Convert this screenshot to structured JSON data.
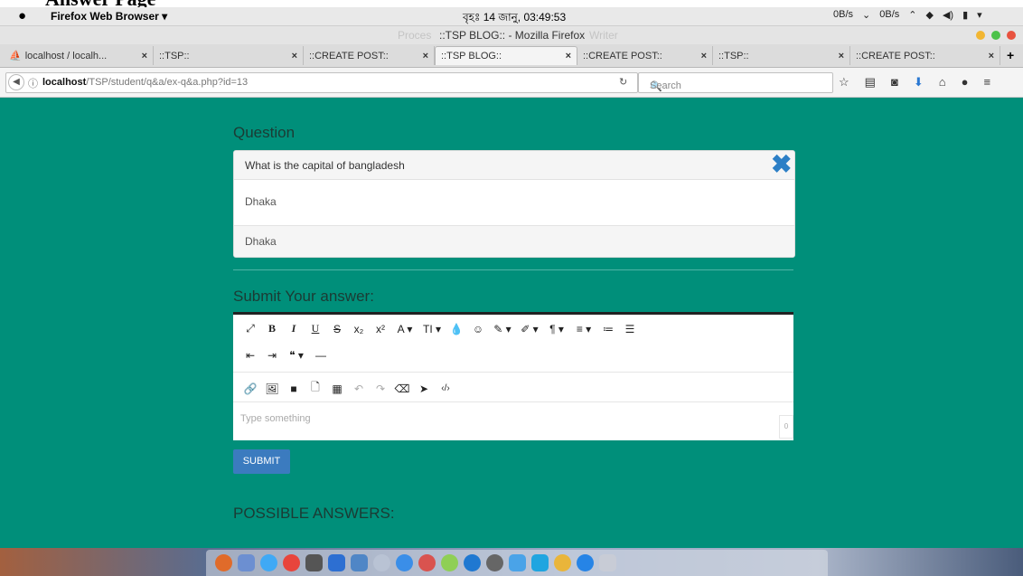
{
  "caption": "Answer Page",
  "menubar": {
    "app_name": "Firefox Web Browser ▾",
    "clock": "বৃহঃ 14 জানু, 03:49:53",
    "status_down": "0B/s",
    "status_up": "0B/s"
  },
  "window": {
    "title": "::TSP BLOG:: - Mozilla Firefox",
    "ghost_left": "Proces",
    "ghost_right": "Writer"
  },
  "tabs": [
    {
      "label": "localhost / localh...",
      "active": false
    },
    {
      "label": "::TSP::",
      "active": false
    },
    {
      "label": "::CREATE POST::",
      "active": false
    },
    {
      "label": "::TSP BLOG::",
      "active": true
    },
    {
      "label": "::CREATE POST::",
      "active": false
    },
    {
      "label": "::TSP::",
      "active": false
    },
    {
      "label": "::CREATE POST::",
      "active": false
    }
  ],
  "tab_close": "×",
  "new_tab": "+",
  "nav": {
    "url_host": "localhost",
    "url_path": "/TSP/student/q&a/ex-q&a.php?id=13",
    "search_placeholder": "Search"
  },
  "page": {
    "question_heading": "Question",
    "question_text": "What is the capital of bangladesh",
    "answer_body": "Dhaka",
    "answer_footer": "Dhaka",
    "submit_heading": "Submit Your answer:",
    "editor_placeholder": "Type something",
    "char_counter": "0",
    "submit_button": "SUBMIT",
    "possible_heading": "POSSIBLE ANSWERS:"
  },
  "toolbar": {
    "row1": [
      "⤢",
      "B",
      "I",
      "U",
      "S",
      "x₂",
      "x²",
      "A ▾",
      "TI ▾",
      "💧",
      "☺",
      "✎ ▾",
      "✐ ▾",
      "¶ ▾",
      "≡ ▾",
      "≔",
      "☰"
    ],
    "row2": [
      "⇤",
      "⇥",
      "❝ ▾",
      "—"
    ],
    "row3": [
      "🔗",
      "🖼",
      "■",
      "🗋",
      "▦",
      "↶",
      "↷",
      "⌫",
      "➤",
      "‹/›"
    ]
  },
  "colors": {
    "page_bg": "#008f7a",
    "submit_bg": "#3b7bbf",
    "close_icon": "#2c7fc6"
  }
}
